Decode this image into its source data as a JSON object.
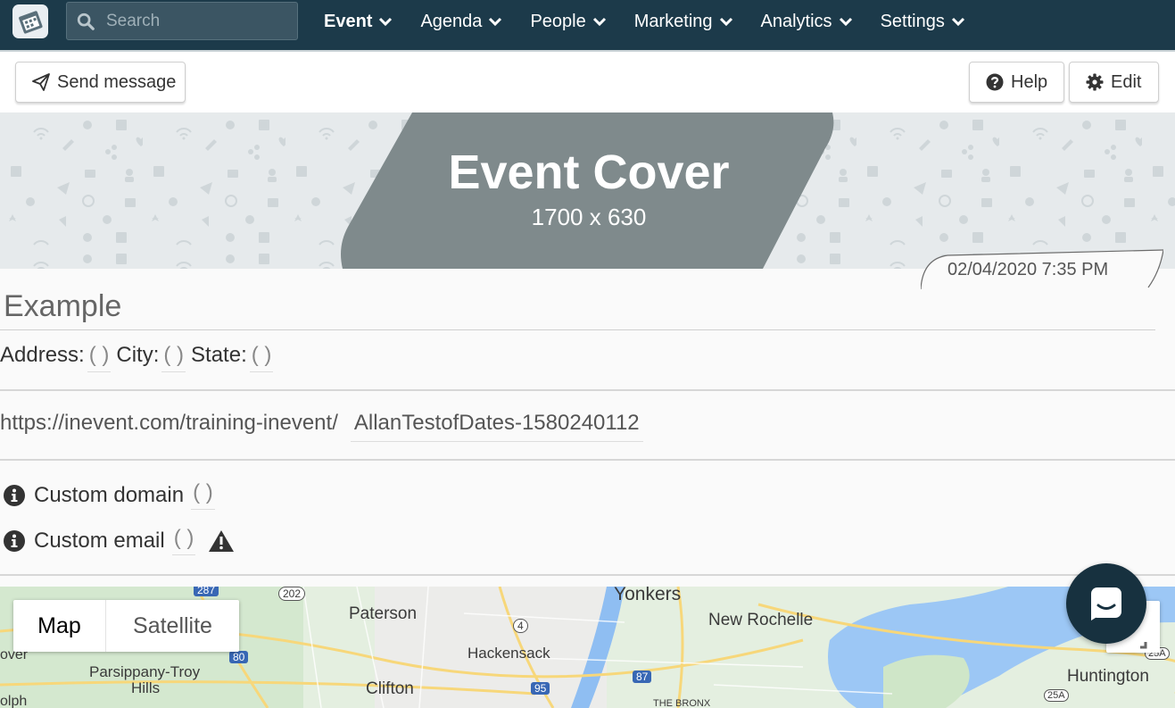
{
  "nav": {
    "search_placeholder": "Search",
    "menu": [
      {
        "label": "Event"
      },
      {
        "label": "Agenda"
      },
      {
        "label": "People"
      },
      {
        "label": "Marketing"
      },
      {
        "label": "Analytics"
      },
      {
        "label": "Settings"
      }
    ]
  },
  "toolbar": {
    "send_label": "Send message",
    "help_label": "Help",
    "edit_label": "Edit"
  },
  "cover": {
    "title": "Event Cover",
    "dimensions": "1700 x 630",
    "datetime": "02/04/2020 7:35 PM"
  },
  "event": {
    "name": "Example",
    "address_label": "Address:",
    "address_value": "( )",
    "city_label": "City:",
    "city_value": "( )",
    "state_label": "State:",
    "state_value": "( )",
    "url_prefix": "https://inevent.com/training-inevent/",
    "url_slug": "AllanTestofDates-1580240112",
    "custom_domain_label": "Custom domain",
    "custom_domain_value": "( )",
    "custom_email_label": "Custom email",
    "custom_email_value": "( )"
  },
  "map": {
    "map_label": "Map",
    "satellite_label": "Satellite",
    "places": [
      "Yonkers",
      "Paterson",
      "New Rochelle",
      "Hackensack",
      "Parsippany-Troy",
      "Hills",
      "Clifton",
      "Huntington",
      "THE BRONX",
      "over",
      "olph"
    ],
    "shields": [
      "287",
      "202",
      "4",
      "80",
      "95",
      "87",
      "25A",
      "25A"
    ]
  },
  "colors": {
    "nav_bg": "#1c3a4a",
    "cover_shape": "#7f8a8c",
    "chat_bg": "#17313f"
  }
}
